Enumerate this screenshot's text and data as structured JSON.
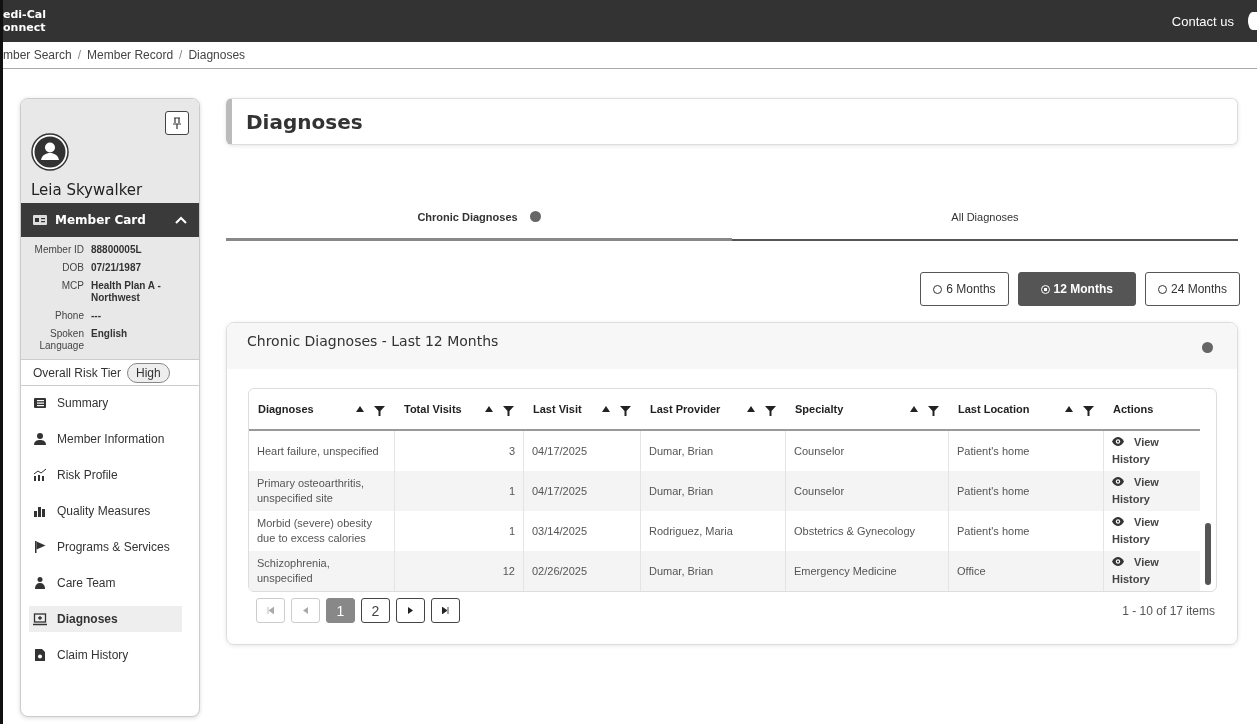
{
  "header": {
    "logo_lines": [
      "edi-Cal",
      "onnect"
    ],
    "contact": "Contact us"
  },
  "breadcrumb": [
    {
      "label": "mber Search"
    },
    {
      "separator": "/",
      "label": "Member Record"
    },
    {
      "separator": "/",
      "label": "Diagnoses"
    }
  ],
  "member": {
    "name": "Leia Skywalker",
    "card_title": "Member Card",
    "expanded": true,
    "fields": [
      {
        "label": "Member ID",
        "value": "88800005L"
      },
      {
        "label": "DOB",
        "value": "07/21/1987"
      },
      {
        "label": "MCP",
        "value": "Health Plan A - Northwest"
      },
      {
        "label": "Phone",
        "value": "---"
      },
      {
        "label": "Spoken Language",
        "value": "English"
      }
    ],
    "risk_label": "Overall Risk Tier",
    "risk_value": "High"
  },
  "nav": [
    {
      "label": "Summary",
      "selected": false
    },
    {
      "label": "Member Information",
      "selected": false
    },
    {
      "label": "Risk Profile",
      "selected": false
    },
    {
      "label": "Quality Measures",
      "selected": false
    },
    {
      "label": "Programs & Services",
      "selected": false
    },
    {
      "label": "Care Team",
      "selected": false
    },
    {
      "label": "Diagnoses",
      "selected": true
    },
    {
      "label": "Claim History",
      "selected": false
    }
  ],
  "page_title": "Diagnoses",
  "tabs": [
    {
      "label": "Chronic Diagnoses",
      "selected": true,
      "help": true
    },
    {
      "label": "All Diagnoses",
      "selected": false,
      "help": false
    }
  ],
  "periods": [
    {
      "label": "6 Months",
      "selected": false
    },
    {
      "label": "12 Months",
      "selected": true
    },
    {
      "label": "24 Months",
      "selected": false
    }
  ],
  "panel_title": "Chronic Diagnoses - Last 12 Months",
  "table": {
    "columns": [
      {
        "label": "Diagnoses",
        "sortable": true
      },
      {
        "label": "Total Visits",
        "sortable": true
      },
      {
        "label": "Last Visit",
        "sortable": true
      },
      {
        "label": "Last Provider",
        "sortable": true
      },
      {
        "label": "Specialty",
        "sortable": true
      },
      {
        "label": "Last Location",
        "sortable": true
      },
      {
        "label": "Actions",
        "sortable": false
      }
    ],
    "rows": [
      {
        "diagnosis": "Heart failure, unspecified",
        "visits": "3",
        "last_visit": "04/17/2025",
        "provider": "Dumar, Brian",
        "specialty": "Counselor",
        "location": "Patient's home",
        "action": "View History"
      },
      {
        "diagnosis": "Primary osteoarthritis, unspecified site",
        "visits": "1",
        "last_visit": "04/17/2025",
        "provider": "Dumar, Brian",
        "specialty": "Counselor",
        "location": "Patient's home",
        "action": "View History"
      },
      {
        "diagnosis": "Morbid (severe) obesity due to excess calories",
        "visits": "1",
        "last_visit": "03/14/2025",
        "provider": "Rodriguez, Maria",
        "specialty": "Obstetrics & Gynecology",
        "location": "Patient's home",
        "action": "View History"
      },
      {
        "diagnosis": "Schizophrenia, unspecified",
        "visits": "12",
        "last_visit": "02/26/2025",
        "provider": "Dumar, Brian",
        "specialty": "Emergency Medicine",
        "location": "Office",
        "action": "View History"
      }
    ]
  },
  "pager": {
    "pages": [
      {
        "label": "1",
        "selected": true
      },
      {
        "label": "2",
        "selected": false
      }
    ],
    "summary": "1 - 10 of 17 items"
  }
}
